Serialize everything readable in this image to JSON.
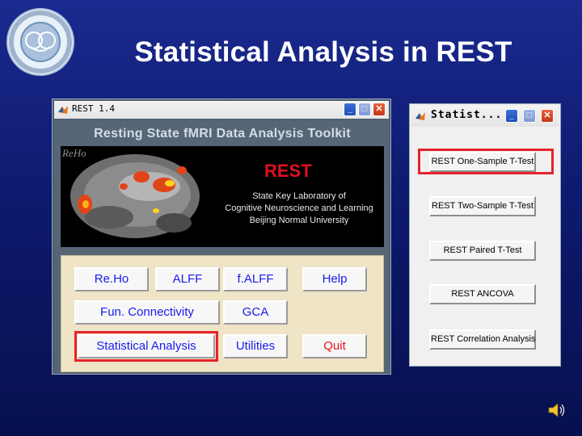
{
  "slide": {
    "title": "Statistical Analysis in REST"
  },
  "colors": {
    "background": "#1a2a8f",
    "title_text": "#ffffff",
    "button_text": "#1a1aee",
    "quit_text": "#e3141c",
    "highlight": "#e5232b",
    "rest_logo_text": "#e0101c"
  },
  "main_window": {
    "title": "REST 1.4",
    "controls": {
      "minimize": "_",
      "maximize": "□",
      "close": "✕"
    },
    "toolkit_title": "Resting State fMRI Data Analysis Toolkit",
    "banner": {
      "image_label": "ReHo",
      "brand": "REST",
      "lab_lines": [
        "State Key Laboratory of",
        "Cognitive Neuroscience and Learning",
        "Beijing Normal University"
      ]
    },
    "buttons": {
      "reho": "Re.Ho",
      "alff": "ALFF",
      "falff": "f.ALFF",
      "help": "Help",
      "fun_connectivity": "Fun. Connectivity",
      "gca": "GCA",
      "statistical_analysis": "Statistical Analysis",
      "utilities": "Utilities",
      "quit": "Quit"
    }
  },
  "stat_window": {
    "title": "Statist...",
    "controls": {
      "minimize": "_",
      "maximize": "□",
      "close": "✕"
    },
    "buttons": [
      "REST One-Sample T-Test",
      "REST Two-Sample T-Test",
      "REST Paired T-Test",
      "REST ANCOVA",
      "REST Correlation Analysis"
    ]
  },
  "icons": {
    "logo": "university-logo-icon",
    "matlab": "matlab-icon",
    "speaker": "speaker-icon"
  }
}
